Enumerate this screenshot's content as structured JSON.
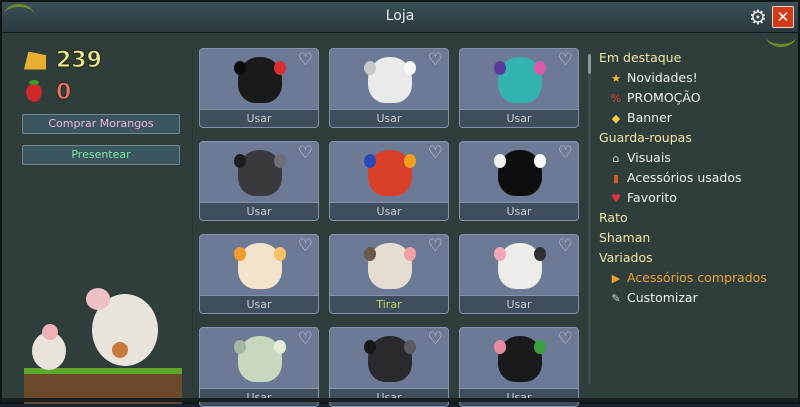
{
  "window": {
    "title": "Loja"
  },
  "icons": {
    "settings": "gear-icon",
    "close": "close-icon",
    "favorite": "heart-outline-icon"
  },
  "currency": {
    "cheese": "239",
    "strawberries": "0",
    "cheese_color": "#e8e8a0",
    "strawberry_color": "#e8707a"
  },
  "buttons": {
    "buy_strawberries": "Comprar Morangos",
    "gift": "Presentear",
    "buy_color": "#f2b6e4",
    "gift_color": "#7ee89e"
  },
  "items": [
    {
      "action": "Usar",
      "body": "#1a1a1a",
      "ear": "#0c0c0c",
      "accent": "#d83030"
    },
    {
      "action": "Usar",
      "body": "#eaeaea",
      "ear": "#c8c8c8",
      "accent": "#f8f8f8"
    },
    {
      "action": "Usar",
      "body": "#33b3b0",
      "ear": "#5a3a9a",
      "accent": "#d85aa8"
    },
    {
      "action": "Usar",
      "body": "#3a3a3e",
      "ear": "#1e1e1e",
      "accent": "#6e6e78"
    },
    {
      "action": "Usar",
      "body": "#d8402a",
      "ear": "#2a4ab8",
      "accent": "#f0a020"
    },
    {
      "action": "Usar",
      "body": "#0e0e0e",
      "ear": "#f0f0f0",
      "accent": "#f8f8f8"
    },
    {
      "action": "Usar",
      "body": "#f3e3cc",
      "ear": "#f09a30",
      "accent": "#f6c36a"
    },
    {
      "action": "Tirar",
      "body": "#e4ddd0",
      "ear": "#6b5a4a",
      "accent": "#f0a0a0"
    },
    {
      "action": "Usar",
      "body": "#ecece8",
      "ear": "#f0a8b8",
      "accent": "#303030"
    },
    {
      "action": "Usar",
      "body": "#c8d8c0",
      "ear": "#a6b8a2",
      "accent": "#e4ecd8"
    },
    {
      "action": "Usar",
      "body": "#2a2a2e",
      "ear": "#181818",
      "accent": "#5a5a60"
    },
    {
      "action": "Usar",
      "body": "#1a1a1a",
      "ear": "#e88aa0",
      "accent": "#3aa040"
    }
  ],
  "menu": [
    {
      "type": "head",
      "label": "Em destaque"
    },
    {
      "type": "item",
      "icon": "★",
      "icon_color": "#f0c030",
      "label": "Novidades!"
    },
    {
      "type": "item",
      "icon": "%",
      "icon_color": "#e04040",
      "label": "PROMOÇÃO"
    },
    {
      "type": "item",
      "icon": "◆",
      "icon_color": "#f0d040",
      "label": "Banner"
    },
    {
      "type": "head",
      "label": "Guarda-roupas"
    },
    {
      "type": "item",
      "icon": "⌂",
      "icon_color": "#d0d0d0",
      "label": "Visuais"
    },
    {
      "type": "item",
      "icon": "▮",
      "icon_color": "#d05a20",
      "label": "Acessórios usados"
    },
    {
      "type": "item",
      "icon": "♥",
      "icon_color": "#e83040",
      "label": "Favorito"
    },
    {
      "type": "head",
      "label": "Rato"
    },
    {
      "type": "head",
      "label": "Shaman"
    },
    {
      "type": "head",
      "label": "Variados"
    },
    {
      "type": "item",
      "icon": "▶",
      "icon_color": "#e8a030",
      "label": "Acessórios comprados",
      "selected": true
    },
    {
      "type": "item",
      "icon": "✎",
      "icon_color": "#d0d0d0",
      "label": "Customizar"
    }
  ]
}
